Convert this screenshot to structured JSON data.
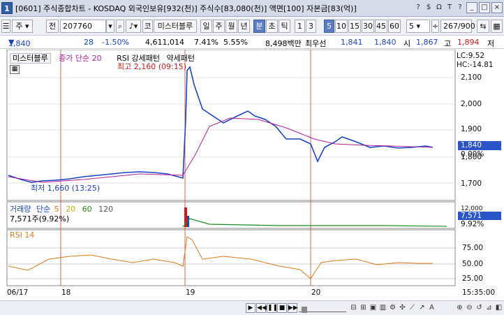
{
  "window": {
    "title": "[0601] 주식종합차트 - KOSDAQ 외국인보유[932(천)] 주식수[83,080(천)] 액면[100] 자본금[83(억)]",
    "app_icon": "1",
    "title_buttons": [
      "?",
      "$",
      "Ω",
      "T",
      "?"
    ],
    "window_buttons": [
      "_",
      "□",
      "×"
    ]
  },
  "toolbar": {
    "market_label": "주",
    "market_sel": "▾",
    "jeon_label": "전",
    "code_value": "207760",
    "name_value": "미스터블루",
    "kodaq_btn": "코",
    "period_buttons": [
      "일",
      "주",
      "월",
      "년",
      "분",
      "초",
      "틱"
    ],
    "period_selected": "분",
    "interval_buttons": [
      "1",
      "3",
      "5",
      "10",
      "15",
      "30",
      "45",
      "60"
    ],
    "interval_selected": "5",
    "interval_input": "5",
    "count_value": "267/900"
  },
  "quote": {
    "price": "1,840",
    "change": "28",
    "change_pct": "-1.50%",
    "volume": "4,611,014",
    "vol_ratio": "7.41%",
    "turnover": "5.55%",
    "amount": "8,498백만",
    "priority_label": "최우선",
    "ask": "1,841",
    "bid": "1,840",
    "open_label": "시",
    "open": "1,867",
    "high_label": "고",
    "high": "1,894",
    "low_label": "저"
  },
  "price_panel": {
    "name": "미스터블루",
    "ma_label": "종가 단순 20",
    "rsi_pattern_label": "RSI 강세패턴",
    "weak_pattern_label": "약세패턴",
    "high_annotation": "최고 2,160 (09:15)",
    "low_annotation": "최저 1,660 (13:25)",
    "lc_label": "LC:9.52",
    "hc_label": "HC:-14.81",
    "current_price_tag": "1,840",
    "current_pct_tag": "0.00%",
    "y_ticks": [
      "2,100",
      "2,000",
      "1,900",
      "1,800",
      "1,700"
    ]
  },
  "volume_panel": {
    "title": "거래량",
    "ma_label": "단순",
    "ma_periods": [
      "5",
      "20",
      "60",
      "120"
    ],
    "value": "7,571주(9.92%)",
    "right_tag": "7,571",
    "right_pct": "9.92%",
    "right_top": "12,000"
  },
  "rsi_panel": {
    "title": "RSI 14",
    "y_ticks": [
      "75.00",
      "50.00",
      "25.00"
    ]
  },
  "x_axis": {
    "labels": [
      "06/17",
      "18",
      "19",
      "20"
    ],
    "time_label": "15:35:00"
  },
  "colors": {
    "up": "#d21919",
    "down": "#1b44c9",
    "ma20": "#b0239b",
    "rsi": "#d97b1a",
    "day_divider": "#c83c3c"
  },
  "statusbar": {
    "nav_icons": [
      "play-icon",
      "first-icon",
      "pause-icon",
      "stop-icon",
      "last-icon"
    ],
    "tool_icons": [
      "zoom-out-icon",
      "zoom-in-icon",
      "grid-icon",
      "chart-icon",
      "settings-icon",
      "cross-icon",
      "trend-icon",
      "plus-icon",
      "minus-icon",
      "text-icon"
    ]
  }
}
